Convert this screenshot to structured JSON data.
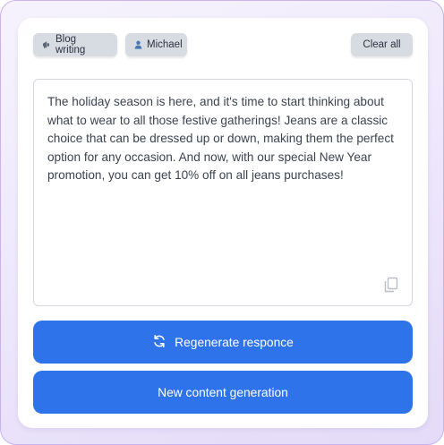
{
  "chips": {
    "topic": {
      "label": "Blog writing",
      "icon": "megaphone-icon"
    },
    "user": {
      "label": "Michael",
      "icon": "user-icon"
    },
    "clear_label": "Clear all"
  },
  "content": {
    "text": "The holiday season is here, and it's time to start thinking about what to wear to all those festive gatherings! Jeans are a classic choice that can be dressed up or down, making them the perfect option for any occasion. And now, with our special New Year promotion, you can get 10% off on all jeans purchases!",
    "copy_icon": "copy-icon"
  },
  "actions": {
    "regenerate_label": "Regenerate responce",
    "regenerate_icon": "refresh-icon",
    "new_content_label": "New content generation"
  },
  "colors": {
    "accent": "#2f73ea",
    "chip_bg": "#d7dbe2",
    "frame_border": "#c9b3ef"
  }
}
